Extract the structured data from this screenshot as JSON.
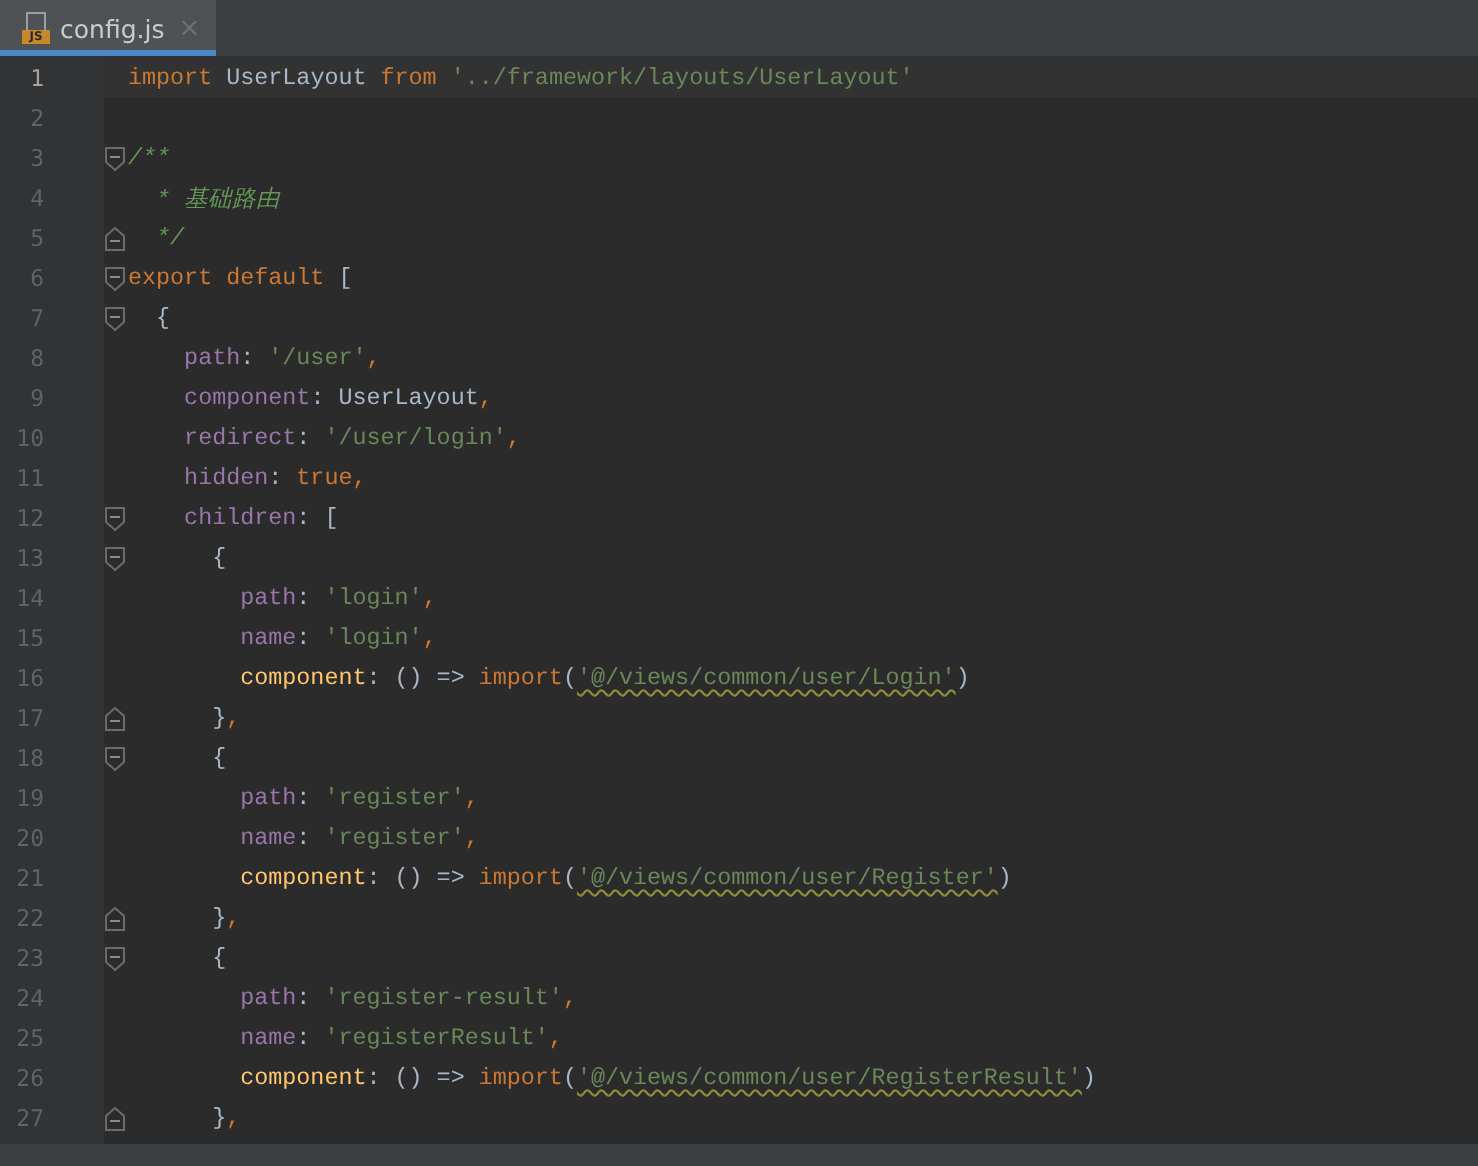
{
  "tabs": [
    {
      "label": "config.js",
      "icon_label": "JS",
      "selected": true,
      "close": "×"
    }
  ],
  "lines": [
    {
      "number": "1",
      "current": true,
      "tokens": [
        {
          "kind": "keyword",
          "text": "import"
        },
        {
          "kind": "plain",
          "text": " UserLayout "
        },
        {
          "kind": "keyword",
          "text": "from "
        },
        {
          "kind": "string",
          "text": "'../framework/layouts/UserLayout'"
        }
      ]
    },
    {
      "number": "2",
      "current": false
    },
    {
      "number": "3",
      "current": false,
      "fold_start": true,
      "tokens": [
        {
          "kind": "comment",
          "text": "/**"
        }
      ]
    },
    {
      "number": "4",
      "current": false,
      "tokens": [
        {
          "kind": "comment",
          "text": "  * 基础路由"
        }
      ]
    },
    {
      "number": "5",
      "current": false,
      "fold_end": true,
      "tokens": [
        {
          "kind": "comment",
          "text": "  */"
        }
      ]
    },
    {
      "number": "6",
      "current": false,
      "fold_start": true,
      "tokens": [
        {
          "kind": "keyword",
          "text": "export default"
        },
        {
          "kind": "plain",
          "text": " ["
        }
      ]
    },
    {
      "number": "7",
      "current": false,
      "fold_start": true,
      "tokens": [
        {
          "kind": "plain",
          "text": "  {"
        }
      ]
    },
    {
      "number": "8",
      "current": false,
      "tokens": [
        {
          "kind": "property",
          "text": "    path"
        },
        {
          "kind": "plain",
          "text": ": "
        },
        {
          "kind": "string",
          "text": "'/user'"
        },
        {
          "kind": "keyword",
          "text": ","
        }
      ]
    },
    {
      "number": "9",
      "current": false,
      "tokens": [
        {
          "kind": "property",
          "text": "    component"
        },
        {
          "kind": "plain",
          "text": ": UserLayout"
        },
        {
          "kind": "keyword",
          "text": ","
        }
      ]
    },
    {
      "number": "10",
      "current": false,
      "tokens": [
        {
          "kind": "property",
          "text": "    redirect"
        },
        {
          "kind": "plain",
          "text": ": "
        },
        {
          "kind": "string",
          "text": "'/user/login'"
        },
        {
          "kind": "keyword",
          "text": ","
        }
      ]
    },
    {
      "number": "11",
      "current": false,
      "tokens": [
        {
          "kind": "property",
          "text": "    hidden"
        },
        {
          "kind": "plain",
          "text": ": "
        },
        {
          "kind": "keyword",
          "text": "true,"
        }
      ]
    },
    {
      "number": "12",
      "current": false,
      "fold_start": true,
      "tokens": [
        {
          "kind": "property",
          "text": "    children"
        },
        {
          "kind": "plain",
          "text": ": ["
        }
      ]
    },
    {
      "number": "13",
      "current": false,
      "fold_start": true,
      "tokens": [
        {
          "kind": "plain",
          "text": "      {"
        }
      ]
    },
    {
      "number": "14",
      "current": false,
      "tokens": [
        {
          "kind": "property",
          "text": "        path"
        },
        {
          "kind": "plain",
          "text": ": "
        },
        {
          "kind": "string",
          "text": "'login'"
        },
        {
          "kind": "keyword",
          "text": ","
        }
      ]
    },
    {
      "number": "15",
      "current": false,
      "tokens": [
        {
          "kind": "property",
          "text": "        name"
        },
        {
          "kind": "plain",
          "text": ": "
        },
        {
          "kind": "string",
          "text": "'login'"
        },
        {
          "kind": "keyword",
          "text": ","
        }
      ]
    },
    {
      "number": "16",
      "current": false,
      "tokens": [
        {
          "kind": "function",
          "text": "        component"
        },
        {
          "kind": "plain",
          "text": ": () => "
        },
        {
          "kind": "keyword",
          "text": "import"
        },
        {
          "kind": "plain",
          "text": "("
        },
        {
          "kind": "module",
          "text": "'@/views/common/user/Login'"
        },
        {
          "kind": "plain",
          "text": ")"
        }
      ]
    },
    {
      "number": "17",
      "current": false,
      "fold_end": true,
      "tokens": [
        {
          "kind": "plain",
          "text": "      }"
        },
        {
          "kind": "keyword",
          "text": ","
        }
      ]
    },
    {
      "number": "18",
      "current": false,
      "fold_start": true,
      "tokens": [
        {
          "kind": "plain",
          "text": "      {"
        }
      ]
    },
    {
      "number": "19",
      "current": false,
      "tokens": [
        {
          "kind": "property",
          "text": "        path"
        },
        {
          "kind": "plain",
          "text": ": "
        },
        {
          "kind": "string",
          "text": "'register'"
        },
        {
          "kind": "keyword",
          "text": ","
        }
      ]
    },
    {
      "number": "20",
      "current": false,
      "tokens": [
        {
          "kind": "property",
          "text": "        name"
        },
        {
          "kind": "plain",
          "text": ": "
        },
        {
          "kind": "string",
          "text": "'register'"
        },
        {
          "kind": "keyword",
          "text": ","
        }
      ]
    },
    {
      "number": "21",
      "current": false,
      "tokens": [
        {
          "kind": "function",
          "text": "        component"
        },
        {
          "kind": "plain",
          "text": ": () => "
        },
        {
          "kind": "keyword",
          "text": "import"
        },
        {
          "kind": "plain",
          "text": "("
        },
        {
          "kind": "module",
          "text": "'@/views/common/user/Register'"
        },
        {
          "kind": "plain",
          "text": ")"
        }
      ]
    },
    {
      "number": "22",
      "current": false,
      "fold_end": true,
      "tokens": [
        {
          "kind": "plain",
          "text": "      }"
        },
        {
          "kind": "keyword",
          "text": ","
        }
      ]
    },
    {
      "number": "23",
      "current": false,
      "fold_start": true,
      "tokens": [
        {
          "kind": "plain",
          "text": "      {"
        }
      ]
    },
    {
      "number": "24",
      "current": false,
      "tokens": [
        {
          "kind": "property",
          "text": "        path"
        },
        {
          "kind": "plain",
          "text": ": "
        },
        {
          "kind": "string",
          "text": "'register-result'"
        },
        {
          "kind": "keyword",
          "text": ","
        }
      ]
    },
    {
      "number": "25",
      "current": false,
      "tokens": [
        {
          "kind": "property",
          "text": "        name"
        },
        {
          "kind": "plain",
          "text": ": "
        },
        {
          "kind": "string",
          "text": "'registerResult'"
        },
        {
          "kind": "keyword",
          "text": ","
        }
      ]
    },
    {
      "number": "26",
      "current": false,
      "tokens": [
        {
          "kind": "function",
          "text": "        component"
        },
        {
          "kind": "plain",
          "text": ": () => "
        },
        {
          "kind": "keyword",
          "text": "import"
        },
        {
          "kind": "plain",
          "text": "("
        },
        {
          "kind": "module",
          "text": "'@/views/common/user/RegisterResult'"
        },
        {
          "kind": "plain",
          "text": ")"
        }
      ]
    },
    {
      "number": "27",
      "current": false,
      "fold_end": true,
      "tokens": [
        {
          "kind": "plain",
          "text": "      }"
        },
        {
          "kind": "keyword",
          "text": ","
        }
      ]
    }
  ]
}
